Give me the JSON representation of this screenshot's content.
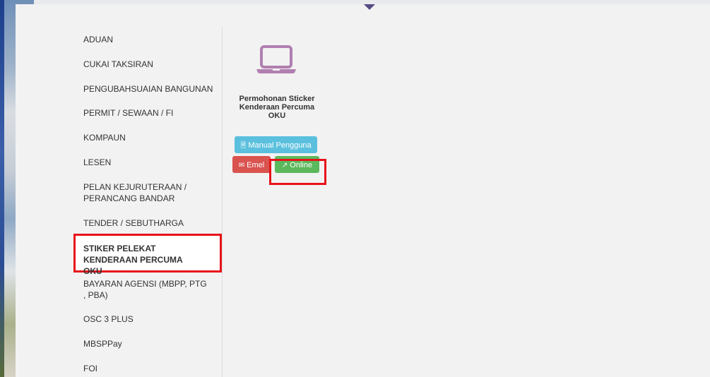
{
  "menu": {
    "items": [
      {
        "label": "ADUAN"
      },
      {
        "label": "CUKAI TAKSIRAN"
      },
      {
        "label": "PENGUBAHSUAIAN BANGUNAN"
      },
      {
        "label": "PERMIT / SEWAAN / FI"
      },
      {
        "label": "KOMPAUN"
      },
      {
        "label": "LESEN"
      },
      {
        "label": "PELAN KEJURUTERAAN / PERANCANG BANDAR"
      },
      {
        "label": "TENDER / SEBUTHARGA"
      },
      {
        "label": "STIKER PELEKAT KENDERAAN PERCUMA OKU",
        "active": true
      },
      {
        "label": "BAYARAN AGENSI (MBPP, PTG , PBA)"
      },
      {
        "label": "OSC 3 PLUS"
      },
      {
        "label": "MBSPPay"
      },
      {
        "label": "FOI"
      }
    ]
  },
  "service": {
    "icon": "laptop-icon",
    "title": "Permohonan Sticker Kenderaan Percuma OKU",
    "buttons": {
      "manual": {
        "label": "Manual Pengguna",
        "icon": "pdf-file-icon",
        "color": "#5bc0de"
      },
      "emel": {
        "label": "Emel",
        "icon": "envelope-icon",
        "color": "#d9534f"
      },
      "online": {
        "label": "Online",
        "icon": "external-link-icon",
        "color": "#5cb85c"
      }
    }
  },
  "colors": {
    "accent": "#5a4a82",
    "icon": "#b07fb0",
    "highlight": "#e8121a"
  }
}
